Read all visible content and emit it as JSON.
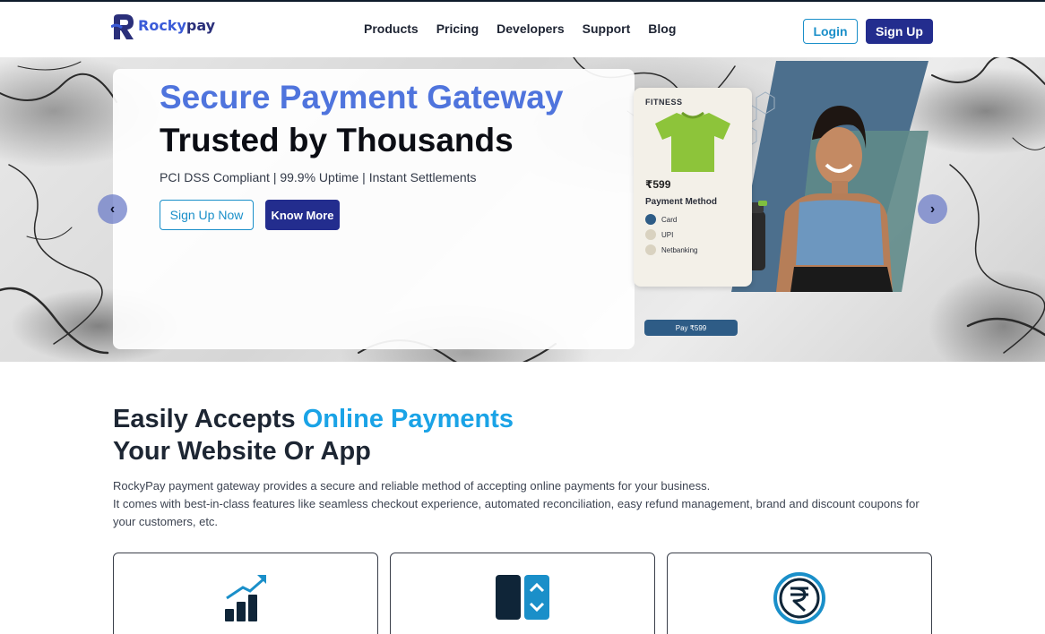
{
  "header": {
    "logo_text_a": "Rocky",
    "logo_text_b": "pay",
    "nav": [
      "Products",
      "Pricing",
      "Developers",
      "Support",
      "Blog"
    ],
    "login_label": "Login",
    "signup_label": "Sign Up"
  },
  "hero": {
    "title_line1": "Secure Payment Gateway",
    "title_line2": "Trusted by Thousands",
    "subtitle": "PCI DSS Compliant | 99.9% Uptime | Instant Settlements",
    "signup_now_label": "Sign Up Now",
    "know_more_label": "Know More",
    "prev_icon": "chevron-left-icon",
    "next_icon": "chevron-right-icon",
    "illustration": {
      "category": "FITNESS",
      "price": "₹599",
      "payment_method_label": "Payment Method",
      "options": [
        "Card",
        "UPI",
        "Netbanking"
      ],
      "pay_button": "Pay ₹599"
    }
  },
  "section": {
    "heading_part1": "Easily Accepts ",
    "heading_accent": "Online Payments",
    "heading_line2": "Your Website Or App",
    "paragraph_line1": "RockyPay payment gateway provides a secure and reliable method of accepting online payments for your business.",
    "paragraph_line2": "It comes with best-in-class features like seamless checkout experience, automated reconciliation, easy refund management, brand and discount coupons for your customers, etc."
  },
  "features": [
    {
      "icon": "growth-chart-icon"
    },
    {
      "icon": "toggle-panel-icon"
    },
    {
      "icon": "rupee-coin-icon"
    }
  ],
  "colors": {
    "brand_dark": "#232d8e",
    "accent_blue": "#1a8fc9",
    "heading_blue": "#4f74dd",
    "section_accent": "#1aa3e6"
  }
}
